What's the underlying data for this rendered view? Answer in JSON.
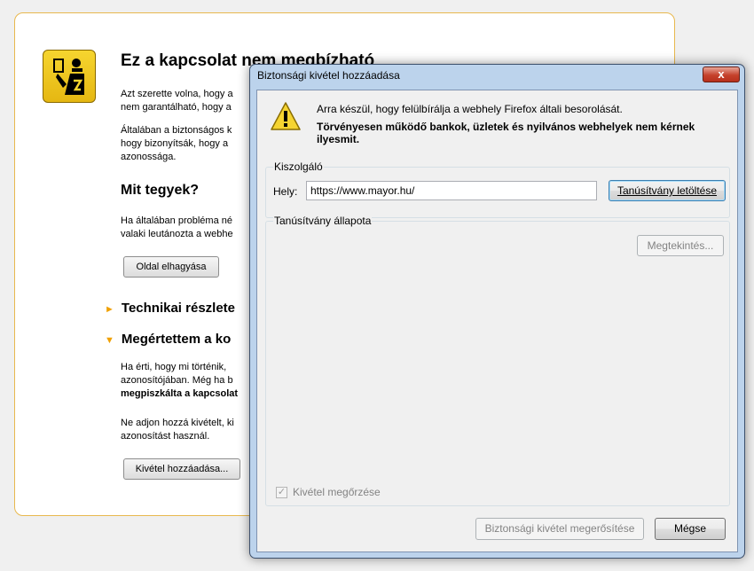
{
  "error_page": {
    "title": "Ez a kapcsolat nem megbízható",
    "intro_lines": [
      "Azt szerette volna, hogy a",
      "nem garantálható, hogy a"
    ],
    "normal_lines": [
      "Általában a biztonságos k",
      "hogy bizonyítsák, hogy a",
      "azonossága."
    ],
    "what_heading": "Mit tegyek?",
    "what_lines": [
      "Ha általában probléma né",
      "valaki leutánozta a webhe"
    ],
    "leave_button": "Oldal elhagyása",
    "tech_details": "Technikai részlete",
    "understand": "Megértettem a ko",
    "risk_lines": [
      "Ha érti, hogy mi történik,",
      "azonosítójában. Még ha b",
      "megpiszkálta a kapcsolat"
    ],
    "no_exception_lines": [
      "Ne adjon hozzá kivételt, ki",
      "azonosítást használ."
    ],
    "add_exception_button": "Kivétel hozzáadása..."
  },
  "dialog": {
    "title": "Biztonsági kivétel hozzáadása",
    "close_glyph": "x",
    "intro": "Arra készül, hogy felülbírálja a webhely Firefox általi besorolását.",
    "warning": "Törvényesen működő bankok, üzletek és nyilvános webhelyek nem kérnek ilyesmit.",
    "server_group": "Kiszolgáló",
    "location_label": "Hely:",
    "location_value": "https://www.mayor.hu/",
    "get_cert_button": "Tanúsítvány letöltése",
    "cert_status_group": "Tanúsítvány állapota",
    "view_button": "Megtekintés...",
    "permanent_checkbox": "Kivétel megőrzése",
    "permanent_checked": true,
    "confirm_button": "Biztonsági kivétel megerősítése",
    "cancel_button": "Mégse"
  }
}
